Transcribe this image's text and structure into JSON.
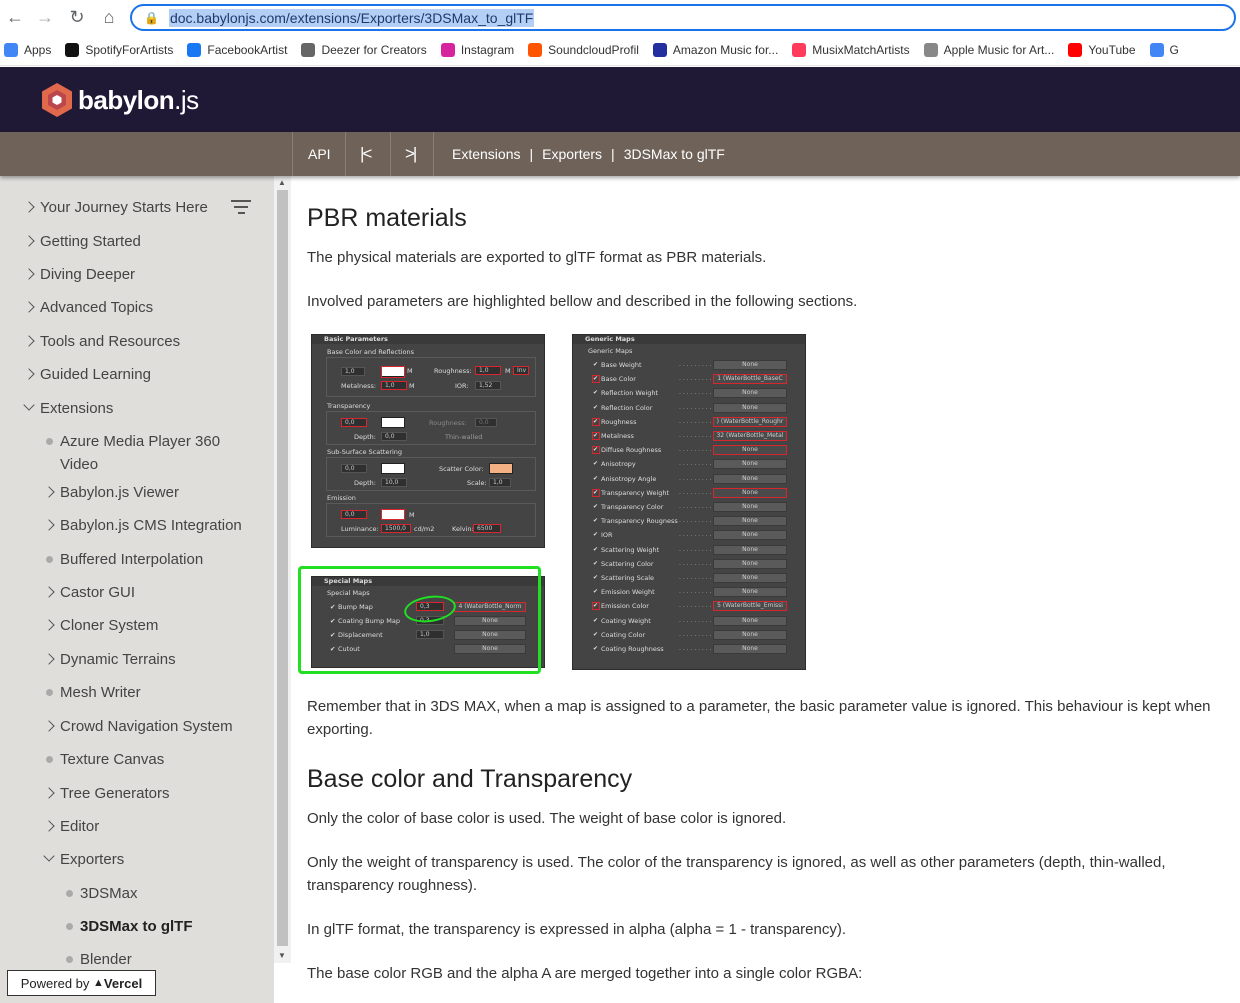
{
  "browser": {
    "url": "doc.babylonjs.com/extensions/Exporters/3DSMax_to_glTF",
    "bookmarks": [
      {
        "label": "Apps",
        "icon": "apps-grid-icon",
        "color": "#4285f4"
      },
      {
        "label": "SpotifyForArtists",
        "icon": "spotify-icon",
        "color": "#111111"
      },
      {
        "label": "FacebookArtist",
        "icon": "meta-icon",
        "color": "#1877f2"
      },
      {
        "label": "Deezer for Creators",
        "icon": "deezer-icon",
        "color": "#666666"
      },
      {
        "label": "Instagram",
        "icon": "instagram-icon",
        "color": "#d6249f"
      },
      {
        "label": "SoundcloudProfil",
        "icon": "soundcloud-icon",
        "color": "#ff5500"
      },
      {
        "label": "Amazon Music for...",
        "icon": "amazon-music-icon",
        "color": "#232f9e"
      },
      {
        "label": "MusixMatchArtists",
        "icon": "musixmatch-icon",
        "color": "#ff3b5c"
      },
      {
        "label": "Apple Music for Art...",
        "icon": "apple-icon",
        "color": "#888888"
      },
      {
        "label": "YouTube",
        "icon": "youtube-icon",
        "color": "#ff0000"
      },
      {
        "label": "G",
        "icon": "google-icon",
        "color": "#4285f4"
      }
    ]
  },
  "site": {
    "logo_text_bold": "babylon",
    "logo_text_light": ".js",
    "accent": "#201936",
    "subnav_color": "#6e6259",
    "api_label": "API",
    "first_label": "|<",
    "last_label": ">|",
    "breadcrumbs": [
      "Extensions",
      "Exporters",
      "3DSMax to glTF"
    ]
  },
  "sidebar": {
    "items": [
      {
        "label": "Your Journey Starts Here",
        "kind": "collapsed",
        "level": 0
      },
      {
        "label": "Getting Started",
        "kind": "collapsed",
        "level": 0
      },
      {
        "label": "Diving Deeper",
        "kind": "collapsed",
        "level": 0
      },
      {
        "label": "Advanced Topics",
        "kind": "collapsed",
        "level": 0
      },
      {
        "label": "Tools and Resources",
        "kind": "collapsed",
        "level": 0
      },
      {
        "label": "Guided Learning",
        "kind": "collapsed",
        "level": 0
      },
      {
        "label": "Extensions",
        "kind": "expanded",
        "level": 0
      },
      {
        "label": "Azure Media Player 360 Video",
        "kind": "leaf",
        "level": 1
      },
      {
        "label": "Babylon.js Viewer",
        "kind": "collapsed",
        "level": 1
      },
      {
        "label": "Babylon.js CMS Integration",
        "kind": "collapsed",
        "level": 1
      },
      {
        "label": "Buffered Interpolation",
        "kind": "leaf",
        "level": 1
      },
      {
        "label": "Castor GUI",
        "kind": "collapsed",
        "level": 1
      },
      {
        "label": "Cloner System",
        "kind": "collapsed",
        "level": 1
      },
      {
        "label": "Dynamic Terrains",
        "kind": "collapsed",
        "level": 1
      },
      {
        "label": "Mesh Writer",
        "kind": "leaf",
        "level": 1
      },
      {
        "label": "Crowd Navigation System",
        "kind": "collapsed",
        "level": 1
      },
      {
        "label": "Texture Canvas",
        "kind": "leaf",
        "level": 1
      },
      {
        "label": "Tree Generators",
        "kind": "collapsed",
        "level": 1
      },
      {
        "label": "Editor",
        "kind": "collapsed",
        "level": 1
      },
      {
        "label": "Exporters",
        "kind": "expanded",
        "level": 1
      },
      {
        "label": "3DSMax",
        "kind": "leaf",
        "level": 2
      },
      {
        "label": "3DSMax to glTF",
        "kind": "leaf",
        "level": 2,
        "active": true
      },
      {
        "label": "Blender",
        "kind": "leaf",
        "level": 2
      }
    ],
    "powered_prefix": "Powered by",
    "powered_brand": "Vercel"
  },
  "content": {
    "h_pbr": "PBR materials",
    "p1": "The physical materials are exported to glTF format as PBR materials.",
    "p2": "Involved parameters are highlighted bellow and described in the following sections.",
    "p3": "Remember that in 3DS MAX, when a map is assigned to a parameter, the basic parameter value is ignored. This behaviour is kept when exporting.",
    "h_base": "Base color and Transparency",
    "p4": "Only the color of base color is used. The weight of base color is ignored.",
    "p5": "Only the weight of transparency is used. The color of the transparency is ignored, as well as other parameters (depth, thin-walled, transparency roughness).",
    "p6": "In glTF format, the transparency is expressed in alpha (alpha = 1 - transparency).",
    "p7": "The base color RGB and the alpha A are merged together into a single color RGBA:"
  },
  "basic_panel": {
    "title": "Basic Parameters",
    "section_bc": "Base Color and Reflections",
    "bc_val": "1,0",
    "metalness_label": "Metalness:",
    "metal_val": "1,0",
    "roughness_label": "Roughness:",
    "rough_val": "1,0",
    "inv_label": "Inv",
    "m_label": "M",
    "ior_label": "IOR:",
    "ior_val": "1,52",
    "section_tr": "Transparency",
    "tr_val": "0,0",
    "depth_label": "Depth:",
    "depth_val": "0,0",
    "tr_rough_label": "Roughness:",
    "tr_rough_val": "0,0",
    "thin_label": "Thin-walled",
    "section_ss": "Sub-Surface Scattering",
    "ss_val": "0,0",
    "scatter_label": "Scatter Color:",
    "ss_depth_val": "10,0",
    "scale_label": "Scale:",
    "scale_val": "1,0",
    "section_em": "Emission",
    "em_val": "0,0",
    "luminance_label": "Luminance:",
    "lum_val": "1500,0",
    "lum_unit": "cd/m2",
    "kelvin_label": "Kelvin:",
    "kelvin_val": "6500",
    "scatter_color": "#f4b183"
  },
  "special_panel": {
    "title": "Special Maps",
    "subtitle": "Special Maps",
    "rows": [
      {
        "label": "Bump Map",
        "value": "0,3",
        "map": "4 (WaterBottle_Norm"
      },
      {
        "label": "Coating Bump Map",
        "value": "0,3",
        "map": "None"
      },
      {
        "label": "Displacement",
        "value": "1,0",
        "map": "None"
      },
      {
        "label": "Cutout",
        "value": "",
        "map": "None"
      }
    ]
  },
  "generic_panel": {
    "title": "Generic Maps",
    "subtitle": "Generic Maps",
    "rows": [
      {
        "label": "Base Weight",
        "map": "None",
        "red": false
      },
      {
        "label": "Base Color",
        "map": "1 (WaterBottle_BaseC",
        "red": true
      },
      {
        "label": "Reflection Weight",
        "map": "None",
        "red": false
      },
      {
        "label": "Reflection Color",
        "map": "None",
        "red": false
      },
      {
        "label": "Roughness",
        "map": ") (WaterBottle_Roughr",
        "red": true
      },
      {
        "label": "Metalness",
        "map": "32 (WaterBottle_Metal",
        "red": true
      },
      {
        "label": "Diffuse Roughness",
        "map": "None",
        "red": true
      },
      {
        "label": "Anisotropy",
        "map": "None",
        "red": false
      },
      {
        "label": "Anisotropy Angle",
        "map": "None",
        "red": false
      },
      {
        "label": "Transparency Weight",
        "map": "None",
        "red": true
      },
      {
        "label": "Transparency Color",
        "map": "None",
        "red": false
      },
      {
        "label": "Transparency Rougness",
        "map": "None",
        "red": false
      },
      {
        "label": "IOR",
        "map": "None",
        "red": false
      },
      {
        "label": "Scattering Weight",
        "map": "None",
        "red": false
      },
      {
        "label": "Scattering Color",
        "map": "None",
        "red": false
      },
      {
        "label": "Scattering Scale",
        "map": "None",
        "red": false
      },
      {
        "label": "Emission Weight",
        "map": "None",
        "red": false
      },
      {
        "label": "Emission Color",
        "map": "5 (WaterBottle_Emissi",
        "red": true
      },
      {
        "label": "Coating Weight",
        "map": "None",
        "red": false
      },
      {
        "label": "Coating Color",
        "map": "None",
        "red": false
      },
      {
        "label": "Coating Roughness",
        "map": "None",
        "red": false
      }
    ]
  }
}
